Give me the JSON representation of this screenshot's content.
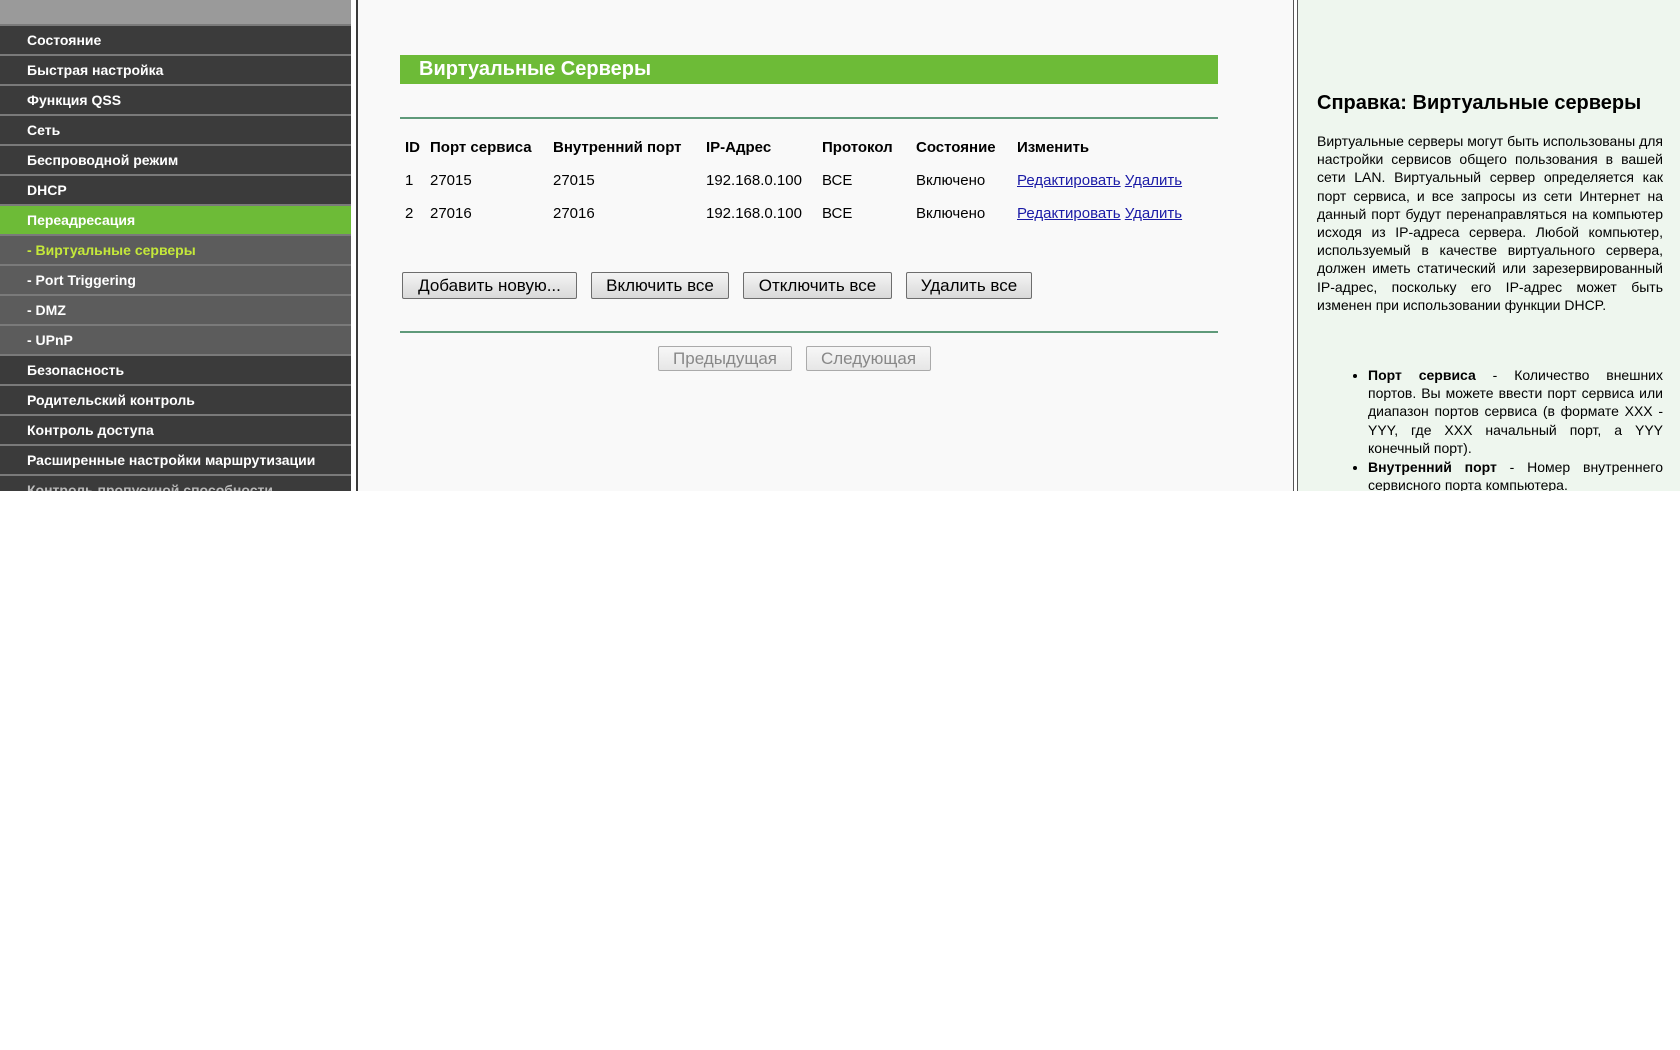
{
  "sidebar": {
    "items": [
      {
        "label": "Состояние",
        "kind": "main"
      },
      {
        "label": "Быстрая настройка",
        "kind": "main"
      },
      {
        "label": "Функция QSS",
        "kind": "main"
      },
      {
        "label": "Сеть",
        "kind": "main"
      },
      {
        "label": "Беспроводной режим",
        "kind": "main"
      },
      {
        "label": "DHCP",
        "kind": "main"
      },
      {
        "label": "Переадресация",
        "kind": "active"
      },
      {
        "label": "- Виртуальные серверы",
        "kind": "sub-active"
      },
      {
        "label": "- Port Triggering",
        "kind": "sub"
      },
      {
        "label": "- DMZ",
        "kind": "sub"
      },
      {
        "label": "- UPnP",
        "kind": "sub"
      },
      {
        "label": "Безопасность",
        "kind": "main"
      },
      {
        "label": "Родительский контроль",
        "kind": "main"
      },
      {
        "label": "Контроль доступа",
        "kind": "main"
      },
      {
        "label": "Расширенные настройки маршрутизации",
        "kind": "main"
      },
      {
        "label": "Контроль пропускной способности",
        "kind": "cut"
      }
    ]
  },
  "main": {
    "title": "Виртуальные Серверы",
    "table": {
      "headers": [
        "ID",
        "Порт сервиса",
        "Внутренний порт",
        "IP-Адрес",
        "Протокол",
        "Состояние",
        "Изменить"
      ],
      "rows": [
        {
          "id": "1",
          "service_port": "27015",
          "internal_port": "27015",
          "ip": "192.168.0.100",
          "protocol": "ВСЕ",
          "status": "Включено",
          "edit": "Редактировать",
          "delete": "Удалить"
        },
        {
          "id": "2",
          "service_port": "27016",
          "internal_port": "27016",
          "ip": "192.168.0.100",
          "protocol": "ВСЕ",
          "status": "Включено",
          "edit": "Редактировать",
          "delete": "Удалить"
        }
      ]
    },
    "buttons": {
      "add": "Добавить новую...",
      "enable_all": "Включить все",
      "disable_all": "Отключить все",
      "delete_all": "Удалить все",
      "prev": "Предыдущая",
      "next": "Следующая"
    }
  },
  "help": {
    "title": "Справка: Виртуальные серверы",
    "intro": "Виртуальные серверы могут быть использованы для настройки сервисов общего пользования в вашей сети LAN. Виртуальный сервер определяется как порт сервиса, и все запросы из сети Интернет на данный порт будут перенаправляться на компьютер исходя из IP-адреса сервера. Любой компьютер, используемый в качестве виртуального сервера, должен иметь статический или зарезервированный IP-адрес, поскольку его IP-адрес может быть изменен при использовании функции DHCP.",
    "items": [
      {
        "term": "Порт сервиса",
        "text": " - Количество внешних портов. Вы можете ввести порт сервиса или диапазон портов сервиса (в формате XXX - YYY, где XXX начальный порт, а YYY конечный порт)."
      },
      {
        "term": "Внутренний порт",
        "text": " - Номер внутреннего сервисного порта компьютера."
      }
    ]
  },
  "colors": {
    "accent_green": "#6dbb37",
    "sidebar_bg": "#3b3b3b",
    "sub_active": "#c4e83a",
    "link": "#1a1aa6",
    "help_bg": "#eef6ee"
  }
}
